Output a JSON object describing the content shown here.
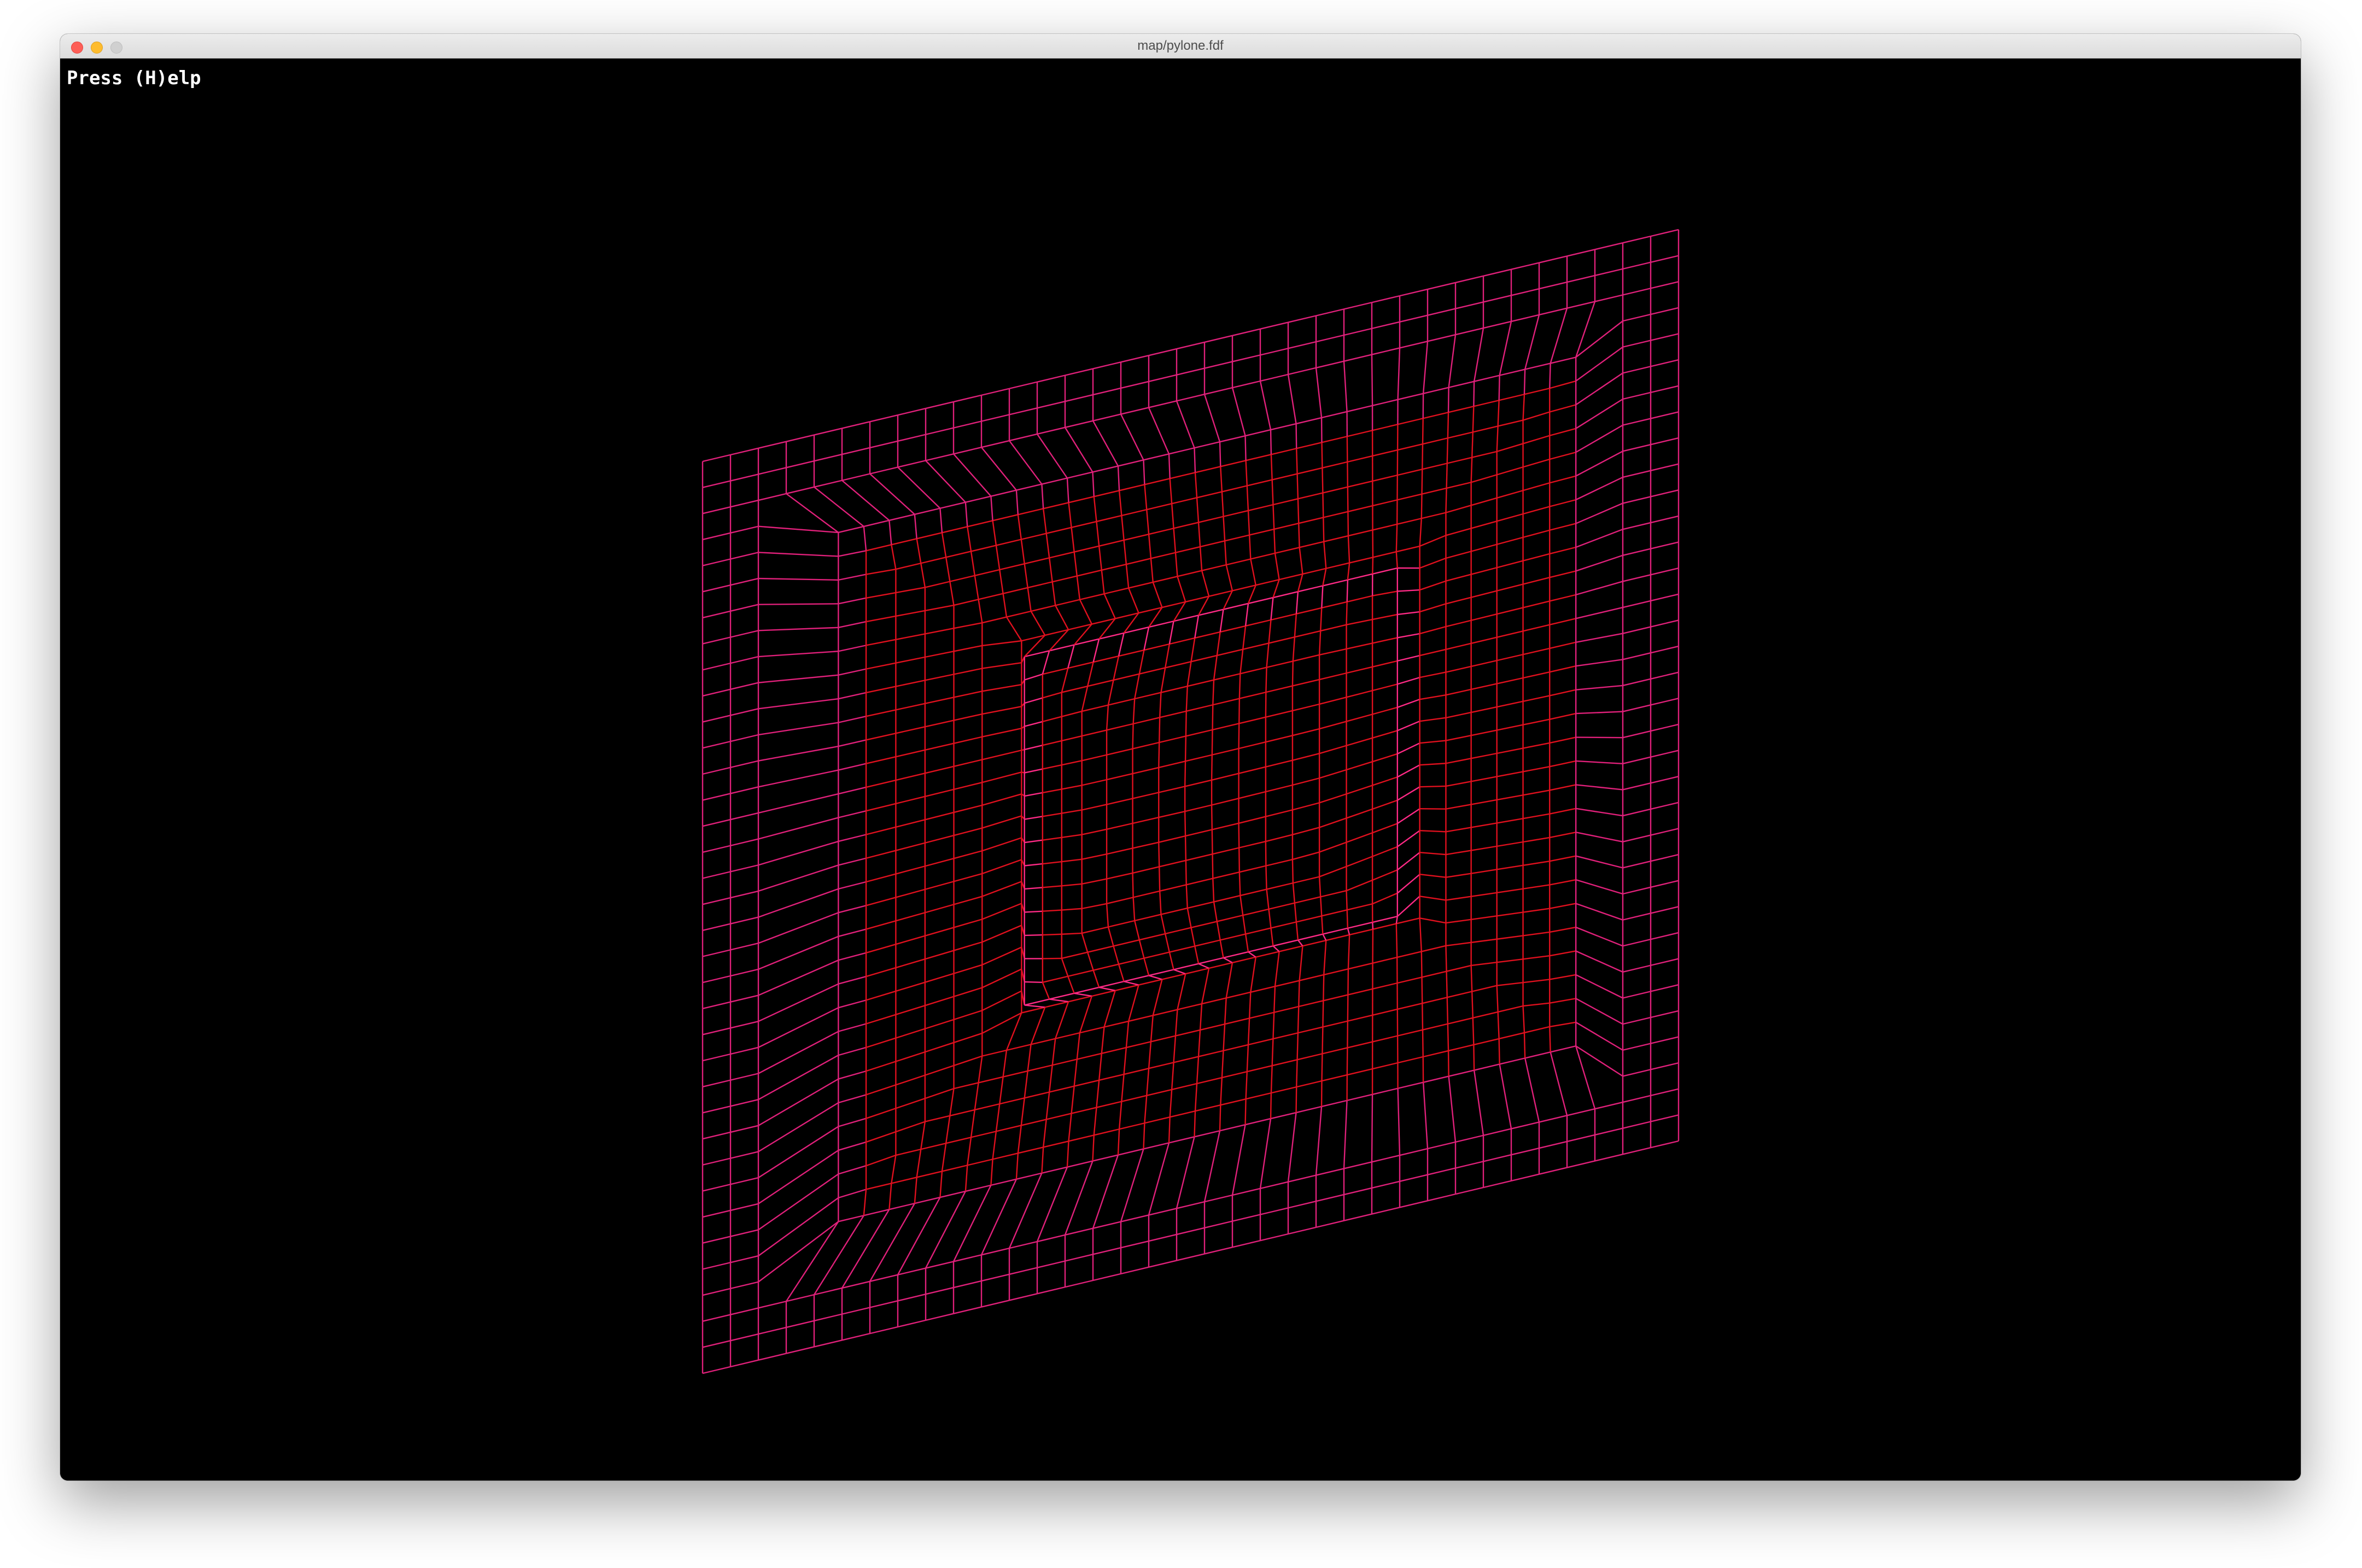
{
  "window": {
    "title": "map/pylone.fdf"
  },
  "overlay": {
    "help_text": "Press (H)elp"
  },
  "wireframe": {
    "grid_columns": 35,
    "grid_rows": 35,
    "colors": {
      "outer_frame": "#e0207a",
      "inner_walls": "#e0101e",
      "ridge": "#ff2a86",
      "background": "#000000"
    }
  }
}
